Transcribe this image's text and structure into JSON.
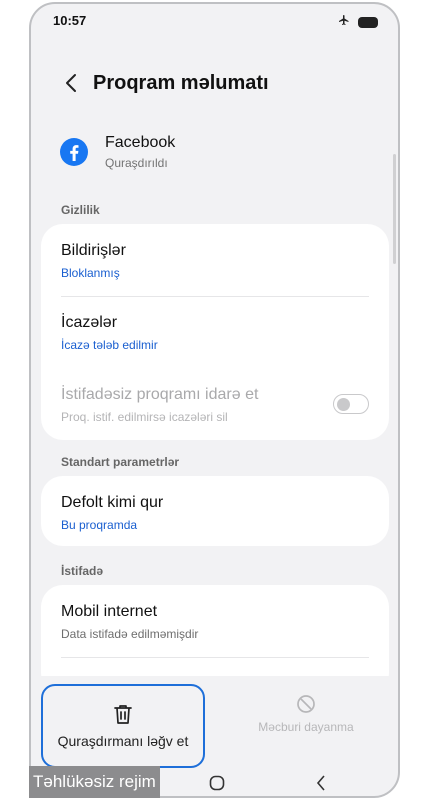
{
  "status_bar": {
    "time": "10:57"
  },
  "header": {
    "title": "Proqram məlumatı"
  },
  "app": {
    "name": "Facebook",
    "status": "Quraşdırıldı",
    "brand_color": "#1877F2"
  },
  "sections": {
    "privacy": {
      "title": "Gizlilik",
      "items": [
        {
          "title": "Bildirişlər",
          "subtitle": "Bloklanmış"
        },
        {
          "title": "İcazələr",
          "subtitle": "İcazə tələb edilmir"
        },
        {
          "title": "İstifadəsiz proqramı idarə et",
          "subtitle": "Proq. istif. edilmirsə icazələri sil",
          "enabled": false,
          "toggle_on": false
        }
      ]
    },
    "defaults": {
      "title": "Standart parametrlər",
      "items": [
        {
          "title": "Defolt kimi qur",
          "subtitle": "Bu proqramda"
        }
      ]
    },
    "usage": {
      "title": "İstifadə",
      "items": [
        {
          "title": "Mobil internet",
          "subtitle": "Data istifadə edilməmişdir"
        }
      ]
    }
  },
  "actions": {
    "uninstall": "Quraşdırmanı ləğv et",
    "force_stop": "Məcburi dayanma"
  },
  "overlay": {
    "safe_mode": "Təhlükəsiz rejim"
  },
  "icons": [
    "back-arrow-icon",
    "airplane-mode-icon",
    "battery-icon",
    "facebook-icon",
    "trash-icon",
    "stop-icon",
    "recents-icon",
    "home-icon",
    "back-nav-icon"
  ]
}
